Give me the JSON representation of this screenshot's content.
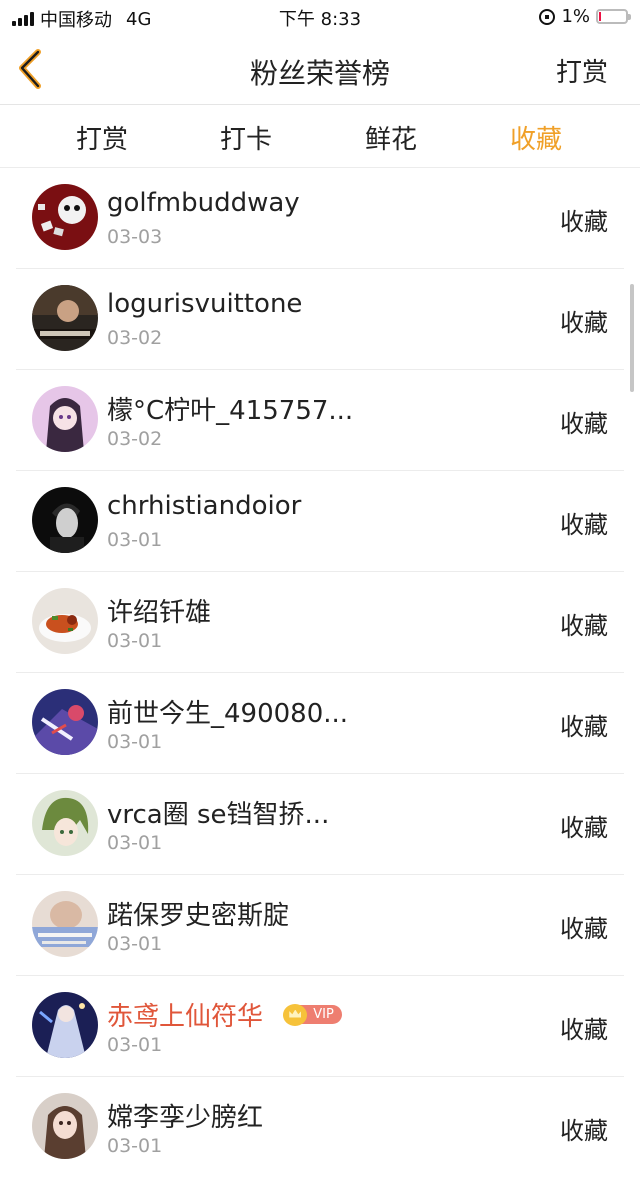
{
  "status": {
    "carrier": "中国移动",
    "network": "4G",
    "time": "下午 8:33",
    "battery": "1%",
    "battery_level": 0.01
  },
  "nav": {
    "title": "粉丝荣誉榜",
    "action": "打赏",
    "back_icon": "chevron-left-icon",
    "accent": "#f0a028"
  },
  "tabs": [
    {
      "label": "打赏",
      "active": false
    },
    {
      "label": "打卡",
      "active": false
    },
    {
      "label": "鲜花",
      "active": false
    },
    {
      "label": "收藏",
      "active": true
    }
  ],
  "fans": [
    {
      "name": "golfmbuddway",
      "date": "03-03",
      "action": "收藏",
      "vip": false
    },
    {
      "name": "logurisvuittone",
      "date": "03-02",
      "action": "收藏",
      "vip": false
    },
    {
      "name": "檬°C柠叶_415757...",
      "date": "03-02",
      "action": "收藏",
      "vip": false
    },
    {
      "name": "chrhistiandoior",
      "date": "03-01",
      "action": "收藏",
      "vip": false
    },
    {
      "name": "许绍钎雄",
      "date": "03-01",
      "action": "收藏",
      "vip": false
    },
    {
      "name": "前世今生_490080...",
      "date": "03-01",
      "action": "收藏",
      "vip": false
    },
    {
      "name": "vrca圈 se铛智挢...",
      "date": "03-01",
      "action": "收藏",
      "vip": false
    },
    {
      "name": "蹃保罗史密斯腚",
      "date": "03-01",
      "action": "收藏",
      "vip": false
    },
    {
      "name": "赤鸢上仙符华",
      "date": "03-01",
      "action": "收藏",
      "vip": true,
      "vip_label": "VIP"
    },
    {
      "name": "嫦李孪少膀红",
      "date": "03-01",
      "action": "收藏",
      "vip": false
    }
  ]
}
